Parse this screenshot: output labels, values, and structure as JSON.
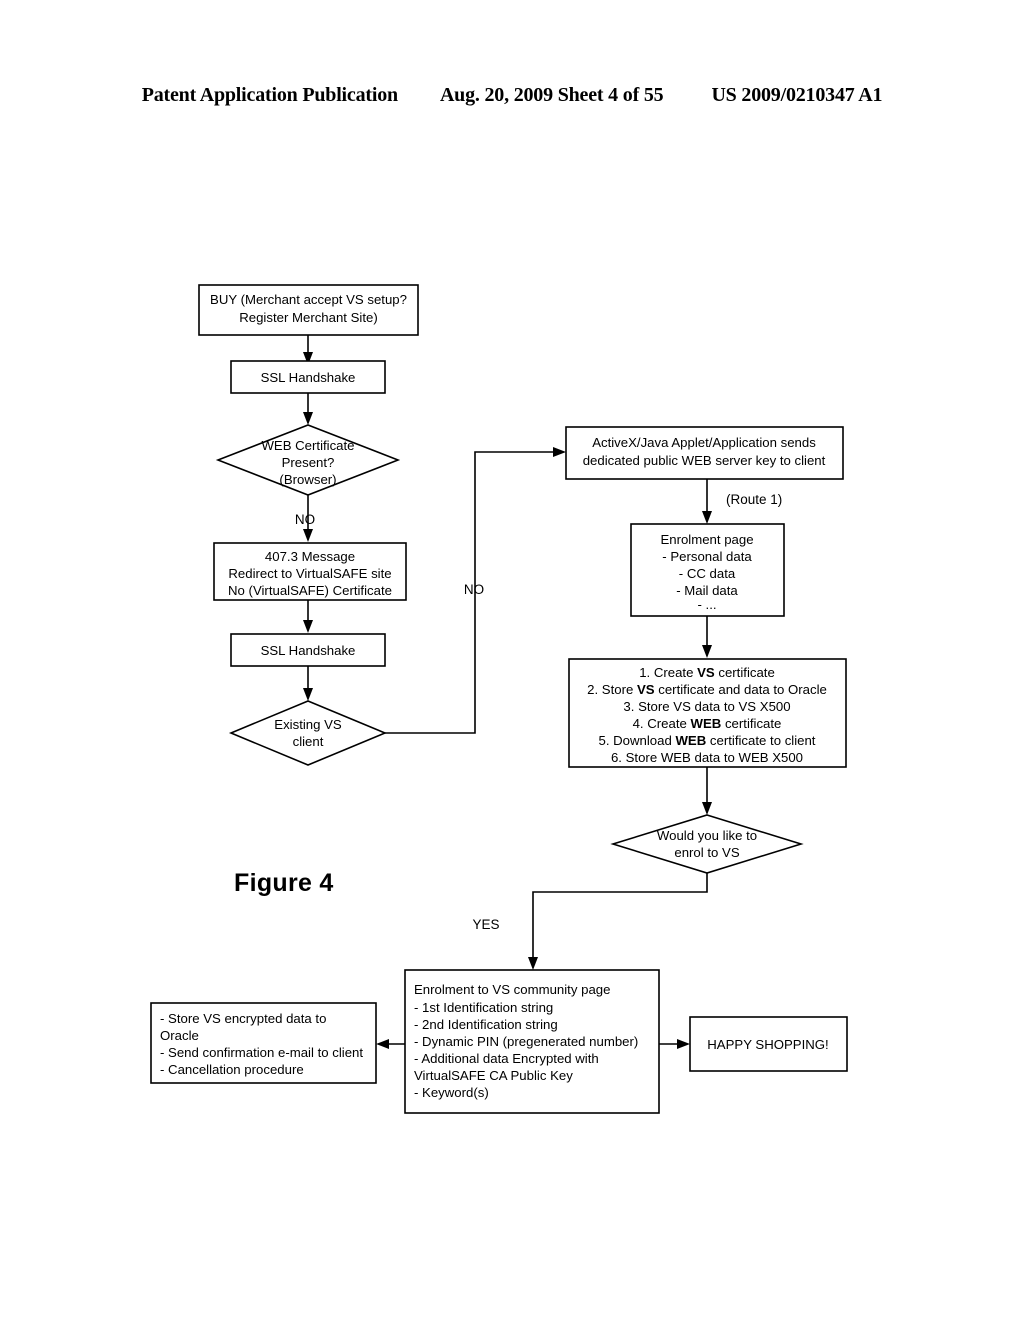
{
  "header": {
    "left": "Patent Application Publication",
    "middle": "Aug. 20, 2009  Sheet 4 of 55",
    "right": "US 2009/0210347 A1"
  },
  "figure": {
    "caption": "Figure 4"
  },
  "flowchart": {
    "type": "flowchart",
    "nodes": [
      {
        "id": "buy",
        "shape": "process",
        "lines": [
          "BUY (Merchant accept VS setup?",
          "Register Merchant Site)"
        ]
      },
      {
        "id": "ssl1",
        "shape": "process",
        "lines": [
          "SSL Handshake"
        ]
      },
      {
        "id": "web-cert",
        "shape": "decision",
        "lines": [
          "WEB Certificate",
          "Present?",
          "(Browser)"
        ]
      },
      {
        "id": "msg407",
        "shape": "process",
        "lines": [
          "407.3 Message",
          "Redirect to VirtualSAFE site",
          "No (VirtualSAFE) Certificate"
        ]
      },
      {
        "id": "ssl2",
        "shape": "process",
        "lines": [
          "SSL Handshake"
        ]
      },
      {
        "id": "existing-vs",
        "shape": "decision",
        "lines": [
          "Existing VS",
          "client"
        ]
      },
      {
        "id": "activex",
        "shape": "process",
        "lines": [
          "ActiveX/Java Applet/Application sends",
          "dedicated public WEB server key to client"
        ]
      },
      {
        "id": "enrolment-page",
        "shape": "process",
        "lines": [
          "Enrolment page",
          "- Personal data",
          "- CC data",
          "- Mail data",
          "- ..."
        ]
      },
      {
        "id": "steps",
        "shape": "process",
        "lines": [
          "1. Create VS certificate",
          "2. Store VS certificate and data to Oracle",
          "3. Store VS data to VS X500",
          "4. Create WEB certificate",
          "5. Download WEB certificate to client",
          "6. Store WEB data to WEB X500"
        ]
      },
      {
        "id": "enrol-question",
        "shape": "decision",
        "lines": [
          "Would you like to",
          "enrol to VS"
        ]
      },
      {
        "id": "community",
        "shape": "process",
        "lines": [
          "Enrolment to VS community page",
          "- 1st Identification string",
          "- 2nd Identification string",
          "- Dynamic PIN (pregenerated number)",
          "- Additional data Encrypted with",
          "VirtualSAFE CA Public Key",
          "- Keyword(s)"
        ]
      },
      {
        "id": "store-vs",
        "shape": "process",
        "lines": [
          "- Store VS encrypted data to",
          "Oracle",
          "- Send confirmation e-mail to client",
          "- Cancellation procedure"
        ]
      },
      {
        "id": "happy",
        "shape": "process",
        "lines": [
          "HAPPY SHOPPING!"
        ]
      }
    ],
    "edge_labels": {
      "web_cert_no": "NO",
      "existing_vs_no": "NO",
      "route1": "(Route 1)",
      "enrol_yes": "YES"
    }
  }
}
